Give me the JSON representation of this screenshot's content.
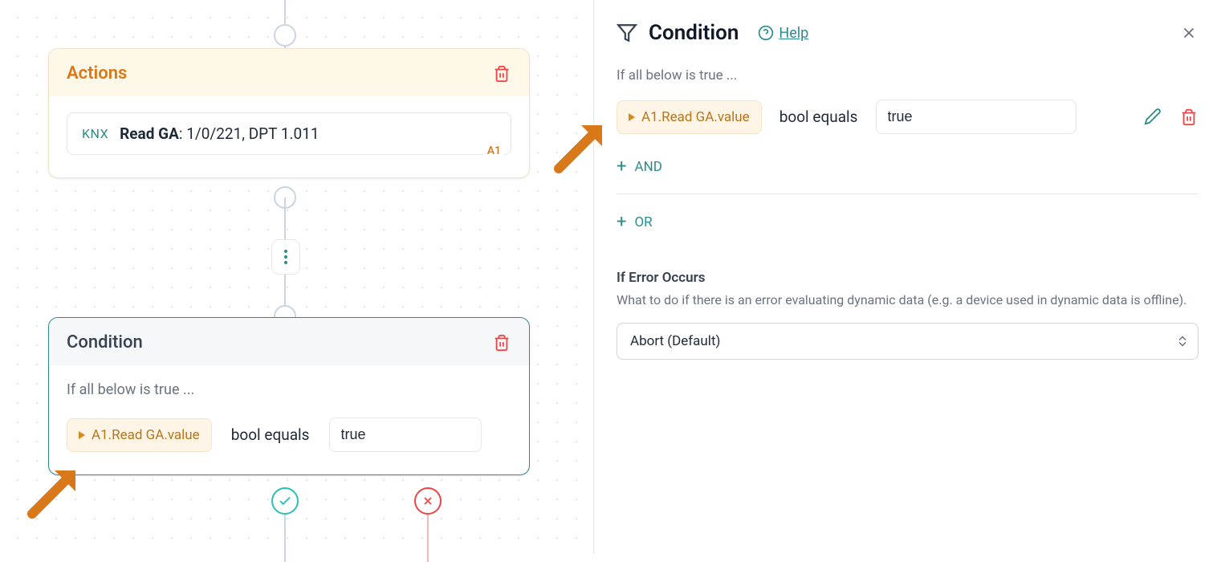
{
  "canvas": {
    "actions": {
      "title": "Actions",
      "knx_label": "KNX",
      "action_text_prefix": "Read GA",
      "action_text_suffix": ": 1/0/221, DPT 1.011",
      "action_id": "A1"
    },
    "condition": {
      "title": "Condition",
      "subtext": "If all below is true ...",
      "token": "A1.Read GA.value",
      "operator": "bool equals",
      "value": "true"
    }
  },
  "sidebar": {
    "title": "Condition",
    "help_label": "Help",
    "subtext": "If all below is true ...",
    "row": {
      "token": "A1.Read GA.value",
      "operator": "bool equals",
      "value": "true"
    },
    "and_label": "AND",
    "or_label": "OR",
    "error_section": {
      "heading": "If Error Occurs",
      "description": "What to do if there is an error evaluating dynamic data (e.g. a device used in dynamic data is offline).",
      "selected": "Abort (Default)"
    }
  }
}
